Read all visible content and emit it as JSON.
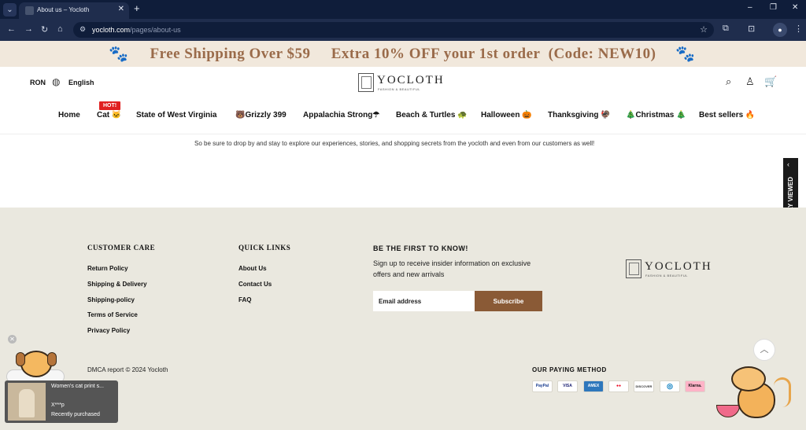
{
  "browser": {
    "tab_title": "About us – Yocloth",
    "url_host": "yocloth.com",
    "url_path": "/pages/about-us"
  },
  "promo": {
    "text": "Free Shipping Over $59     Extra 10% OFF your 1st order  (Code: NEW10)"
  },
  "header": {
    "currency": "RON",
    "language": "English",
    "logo_name": "YOCLOTH",
    "logo_tagline": "FASHION & BEAUTIFUL"
  },
  "nav": {
    "hot_badge": "HOT!",
    "items": [
      "Home",
      "Cat 🐱",
      "State of West Virginia",
      "🐻Grizzly 399",
      "Appalachia Strong☂",
      "Beach & Turtles 🐢",
      "Halloween 🎃",
      "Thanksgiving 🦃",
      "🎄Christmas 🎄",
      "Best sellers 🔥"
    ]
  },
  "about": {
    "text": "So be sure to drop by and stay to explore our experiences, stories, and shopping secrets from the yocloth and even from our customers as well!"
  },
  "footer": {
    "customer_care": {
      "title": "CUSTOMER CARE",
      "links": [
        "Return Policy",
        "Shipping & Delivery",
        "Shipping-policy",
        "Terms of Service",
        "Privacy Policy"
      ]
    },
    "quick_links": {
      "title": "QUICK LINKS",
      "links": [
        "About Us",
        "Contact Us",
        "FAQ"
      ]
    },
    "newsletter": {
      "title": "BE THE FIRST TO KNOW!",
      "description": "Sign up to receive insider information on exclusive offers and new arrivals",
      "email_placeholder": "Email address",
      "subscribe_label": "Subscribe"
    },
    "copyright": "DMCA report © 2024 Yocloth",
    "paying_method_title": "OUR PAYING METHOD",
    "payment_methods": [
      "PayPal",
      "VISA",
      "AMEX",
      "●●",
      "DISCOVER",
      "◎",
      "Klarna."
    ]
  },
  "sidebar": {
    "recently_viewed": "RECENTLY VIEWED"
  },
  "popup": {
    "product": "Women's cat print s...",
    "buyer": "X***p",
    "status": "Recently purchased"
  }
}
